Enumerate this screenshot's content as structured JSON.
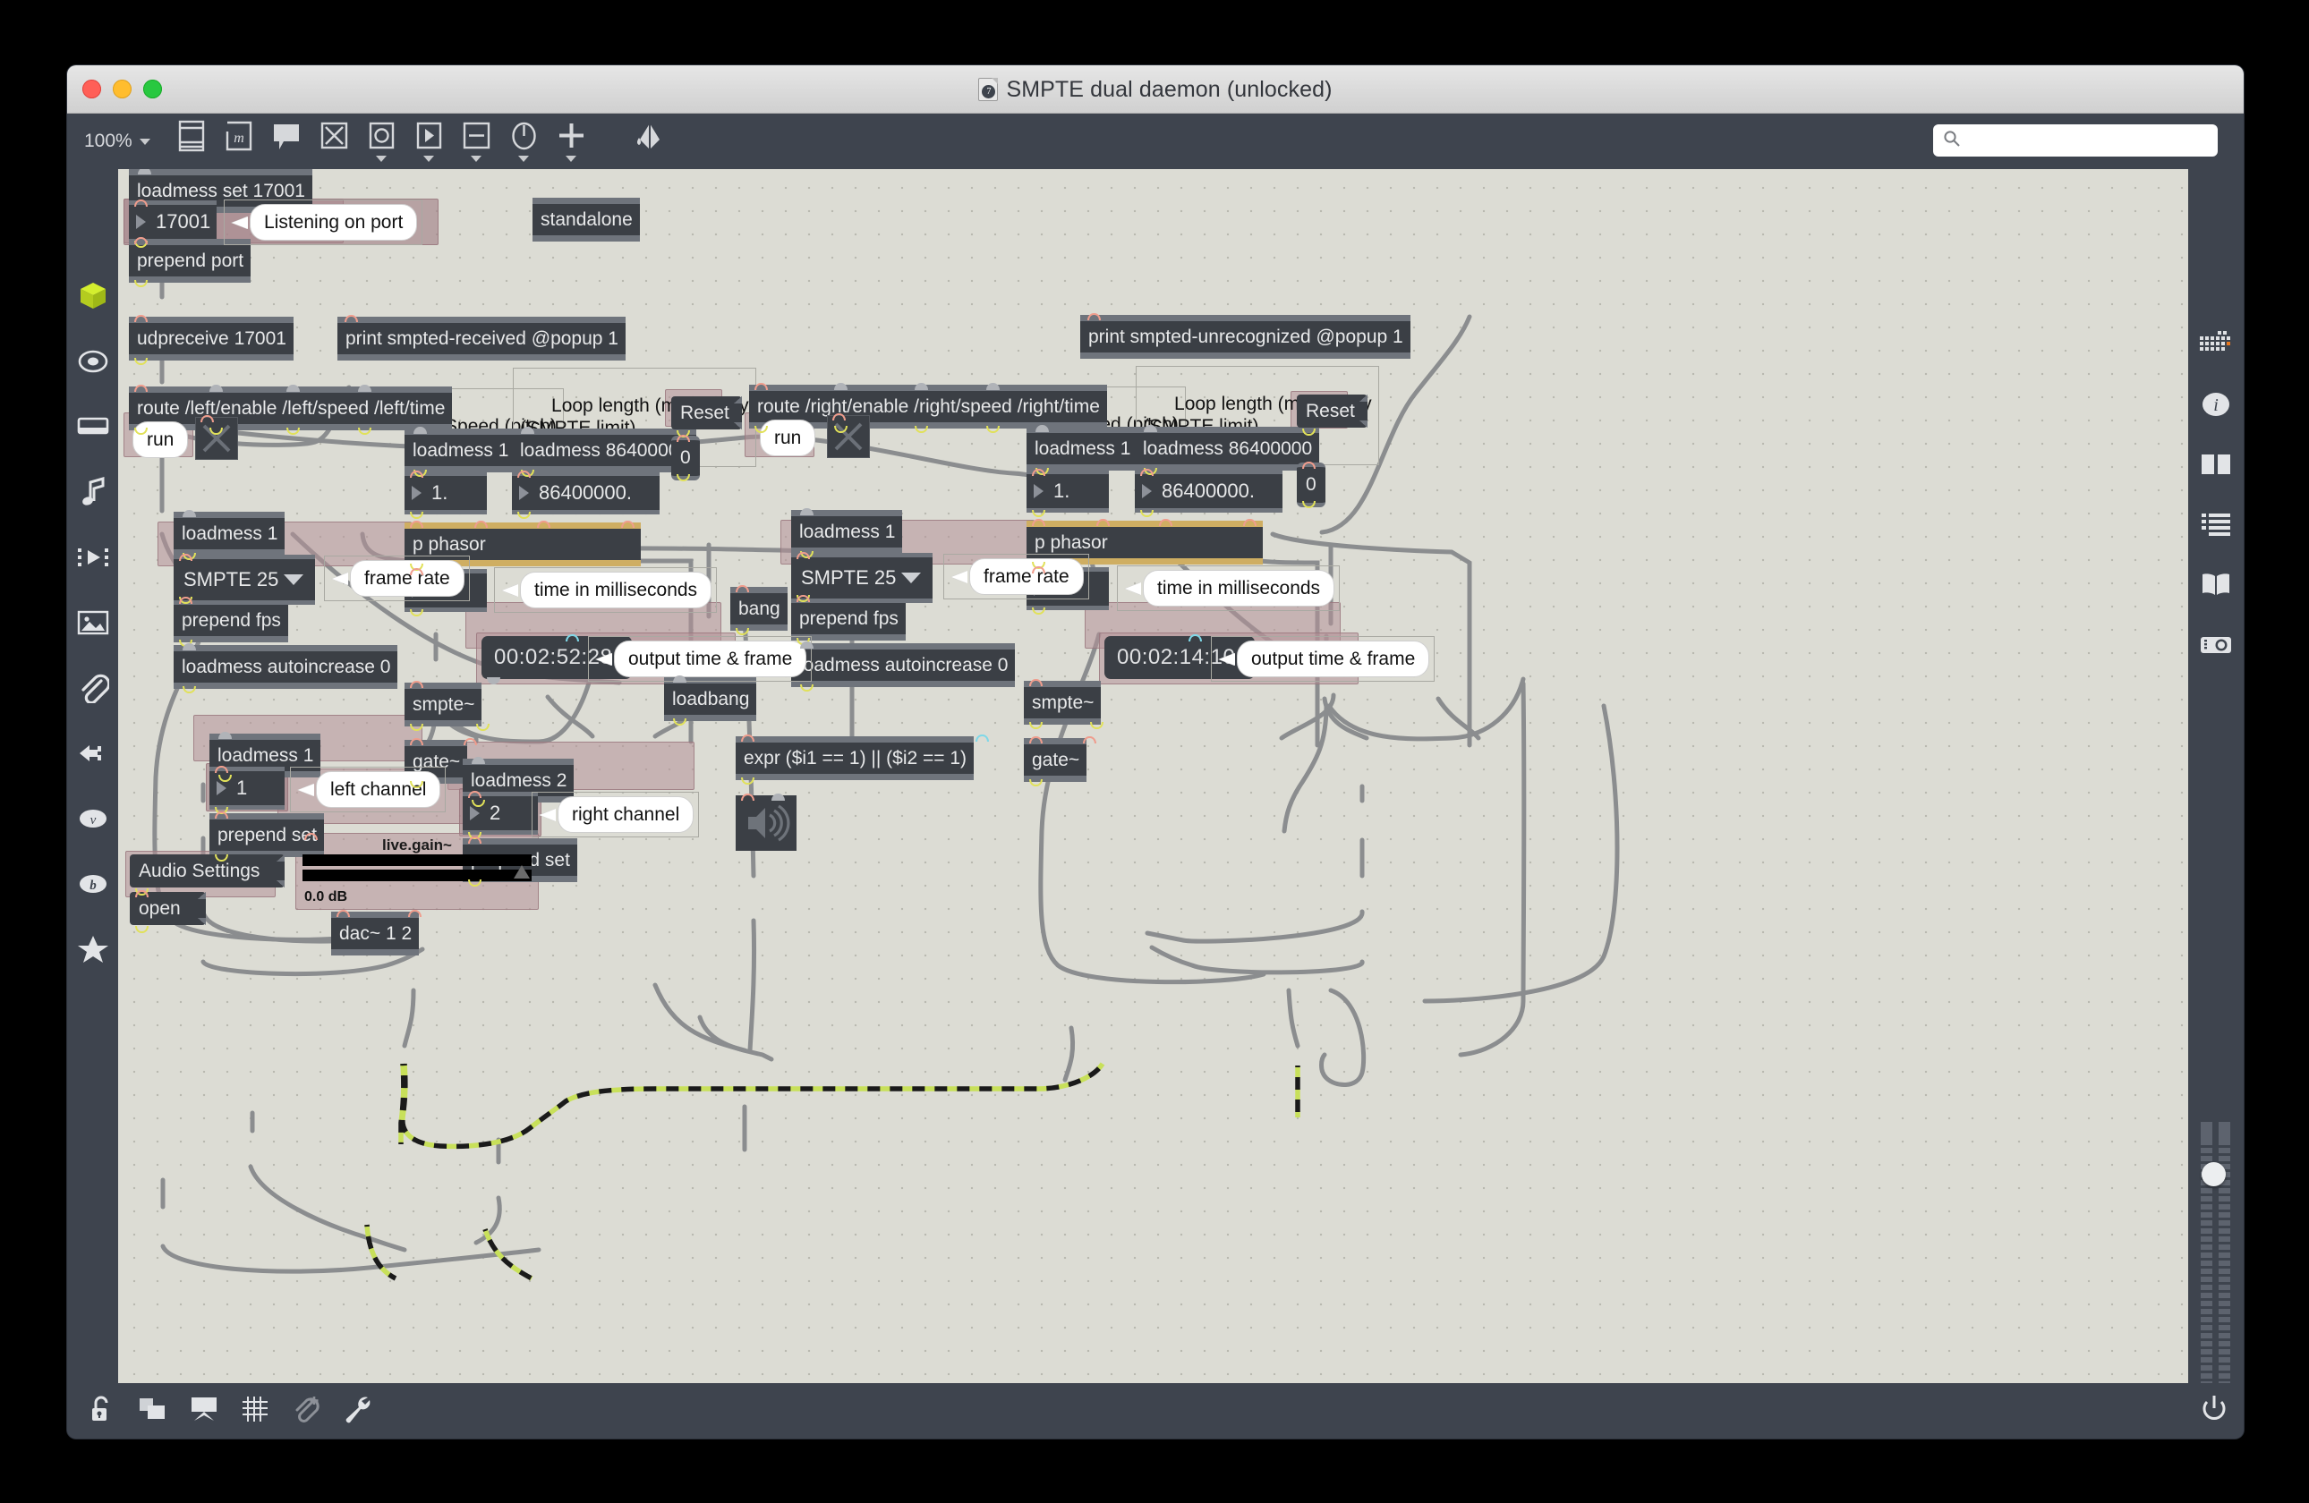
{
  "window": {
    "title": "SMPTE dual daemon (unlocked)",
    "doc_badge": "7"
  },
  "toolbar": {
    "zoom_level": "100%",
    "buttons": [
      {
        "name": "patcher-window-icon",
        "label": "Patcher window"
      },
      {
        "name": "max-object-icon",
        "label": "m"
      },
      {
        "name": "comment-icon",
        "label": "Comment"
      },
      {
        "name": "toggle-icon",
        "label": "Toggle"
      },
      {
        "name": "button-icon",
        "label": "Button"
      },
      {
        "name": "message-icon",
        "label": "Message"
      },
      {
        "name": "number-icon",
        "label": "Number"
      },
      {
        "name": "dial-icon",
        "label": "Dial"
      },
      {
        "name": "plus-icon",
        "label": "Add"
      },
      {
        "name": "paint-bucket-icon",
        "label": "Format"
      }
    ],
    "search_placeholder": ""
  },
  "left_rail": [
    {
      "name": "sidebar-item-packages",
      "icon": "green-cube-icon"
    },
    {
      "name": "sidebar-item-target",
      "icon": "target-icon"
    },
    {
      "name": "sidebar-item-keyboard",
      "icon": "keyboard-icon"
    },
    {
      "name": "sidebar-item-audio",
      "icon": "music-note-icon"
    },
    {
      "name": "sidebar-item-video",
      "icon": "play-film-icon"
    },
    {
      "name": "sidebar-item-image",
      "icon": "picture-icon"
    },
    {
      "name": "sidebar-item-attachment",
      "icon": "paperclip-icon"
    },
    {
      "name": "sidebar-item-plug",
      "icon": "plug-icon"
    },
    {
      "name": "sidebar-item-vizzie",
      "icon": "vizzie-v-icon"
    },
    {
      "name": "sidebar-item-beap",
      "icon": "beap-b-icon"
    },
    {
      "name": "sidebar-item-favorites",
      "icon": "star-icon"
    }
  ],
  "right_rail": [
    {
      "name": "sidebar-item-matrix",
      "icon": "pixel-grid-icon"
    },
    {
      "name": "sidebar-item-info",
      "icon": "info-icon"
    },
    {
      "name": "sidebar-item-panels",
      "icon": "two-panel-icon"
    },
    {
      "name": "sidebar-item-list",
      "icon": "list-icon"
    },
    {
      "name": "sidebar-item-reference",
      "icon": "book-icon"
    },
    {
      "name": "sidebar-item-snapshot",
      "icon": "camera-icon"
    }
  ],
  "bottom_bar": [
    {
      "name": "lock-toggle-button",
      "icon": "unlocked-padlock-icon"
    },
    {
      "name": "presentation-mode-button",
      "icon": "overlapping-squares-icon"
    },
    {
      "name": "presentation-view-button",
      "icon": "presentation-screen-icon"
    },
    {
      "name": "grid-snap-button",
      "icon": "grid-icon"
    },
    {
      "name": "add-attachment-button",
      "icon": "paperclip-plus-icon"
    },
    {
      "name": "inspector-button",
      "icon": "wrench-icon"
    }
  ],
  "power_button": {
    "name": "audio-power-button",
    "icon": "power-icon"
  },
  "patcher": {
    "objects": [
      {
        "id": "loadmess-set-port",
        "text": "loadmess set 17001",
        "type": "object"
      },
      {
        "id": "port-number",
        "text": "17001",
        "type": "number"
      },
      {
        "id": "listening-on-port",
        "text": "Listening on port",
        "type": "bubble"
      },
      {
        "id": "standalone",
        "text": "standalone",
        "type": "object"
      },
      {
        "id": "prepend-port",
        "text": "prepend port",
        "type": "object"
      },
      {
        "id": "udpreceive",
        "text": "udpreceive 17001",
        "type": "object"
      },
      {
        "id": "print-received",
        "text": "print smpted-received @popup 1",
        "type": "object"
      },
      {
        "id": "print-unrecognized",
        "text": "print smpted-unrecognized @popup 1",
        "type": "object"
      },
      {
        "id": "route-left",
        "text": "route /left/enable /left/speed /left/time",
        "type": "object"
      },
      {
        "id": "route-right",
        "text": "route /right/enable /right/speed /right/time",
        "type": "object"
      },
      {
        "id": "run-left",
        "text": "run",
        "type": "bubble"
      },
      {
        "id": "run-right",
        "text": "run",
        "type": "bubble"
      },
      {
        "id": "speed-pitch-left",
        "text": "Speed (pitch)",
        "type": "comment"
      },
      {
        "id": "speed-pitch-right",
        "text": "Speed (pitch)",
        "type": "comment"
      },
      {
        "id": "loop-length-left",
        "text": "Loop length (ms): 1 day\n(SMPTE limit)",
        "type": "comment"
      },
      {
        "id": "loop-length-right",
        "text": "Loop length (ms): 1 day\n(SMPTE limit)",
        "type": "comment"
      },
      {
        "id": "loadmess-1-speed-left",
        "text": "loadmess 1",
        "type": "object"
      },
      {
        "id": "loadmess-1-speed-right",
        "text": "loadmess 1",
        "type": "object"
      },
      {
        "id": "speed-value-left",
        "text": "1.",
        "type": "number"
      },
      {
        "id": "speed-value-right",
        "text": "1.",
        "type": "number"
      },
      {
        "id": "loadmess-loop-left",
        "text": "loadmess 86400000",
        "type": "object"
      },
      {
        "id": "loadmess-loop-right",
        "text": "loadmess 86400000",
        "type": "object"
      },
      {
        "id": "loop-value-left",
        "text": "86400000.",
        "type": "number"
      },
      {
        "id": "loop-value-right",
        "text": "86400000.",
        "type": "number"
      },
      {
        "id": "reset-left",
        "text": "Reset",
        "type": "message"
      },
      {
        "id": "reset-right",
        "text": "Reset",
        "type": "message"
      },
      {
        "id": "reset-int-left",
        "text": "0",
        "type": "intbox"
      },
      {
        "id": "reset-int-right",
        "text": "0",
        "type": "intbox"
      },
      {
        "id": "p-phasor-left",
        "text": "p phasor",
        "type": "subpatcher"
      },
      {
        "id": "p-phasor-right",
        "text": "p phasor",
        "type": "subpatcher"
      },
      {
        "id": "phasor-out-left",
        "text": "0.",
        "type": "number"
      },
      {
        "id": "phasor-out-right",
        "text": "0.",
        "type": "number"
      },
      {
        "id": "time-ms-left",
        "text": "time in milliseconds",
        "type": "bubble"
      },
      {
        "id": "time-ms-right",
        "text": "time in milliseconds",
        "type": "bubble"
      },
      {
        "id": "loadmess-fps-left",
        "text": "loadmess 1",
        "type": "object"
      },
      {
        "id": "loadmess-fps-right",
        "text": "loadmess 1",
        "type": "object"
      },
      {
        "id": "smpte-menu-left",
        "text": "SMPTE 25",
        "type": "umenu"
      },
      {
        "id": "smpte-menu-right",
        "text": "SMPTE 25",
        "type": "umenu"
      },
      {
        "id": "frame-rate-left",
        "text": "frame rate",
        "type": "bubble"
      },
      {
        "id": "frame-rate-right",
        "text": "frame rate",
        "type": "bubble"
      },
      {
        "id": "prepend-fps-left",
        "text": "prepend fps",
        "type": "object"
      },
      {
        "id": "prepend-fps-right",
        "text": "prepend fps",
        "type": "object"
      },
      {
        "id": "autoincrease-left",
        "text": "loadmess autoincrease 0",
        "type": "object"
      },
      {
        "id": "autoincrease-right",
        "text": "loadmess autoincrease 0",
        "type": "object"
      },
      {
        "id": "smpte-time-left",
        "text": "00:02:52:28",
        "type": "smpte-display"
      },
      {
        "id": "smpte-time-right",
        "text": "00:02:14:10",
        "type": "smpte-display"
      },
      {
        "id": "output-frame-left",
        "text": "output time & frame",
        "type": "bubble"
      },
      {
        "id": "output-frame-right",
        "text": "output time & frame",
        "type": "bubble"
      },
      {
        "id": "smpte-tilde-left",
        "text": "smpte~",
        "type": "object"
      },
      {
        "id": "smpte-tilde-right",
        "text": "smpte~",
        "type": "object"
      },
      {
        "id": "gate-tilde-left",
        "text": "gate~",
        "type": "object"
      },
      {
        "id": "gate-tilde-right",
        "text": "gate~",
        "type": "object"
      },
      {
        "id": "bang",
        "text": "bang",
        "type": "object"
      },
      {
        "id": "loadbang",
        "text": "loadbang",
        "type": "object"
      },
      {
        "id": "expr",
        "text": "expr ($i1 == 1) || ($i2 == 1)",
        "type": "object"
      },
      {
        "id": "loadmess-1-chan",
        "text": "loadmess 1",
        "type": "object"
      },
      {
        "id": "loadmess-2-chan",
        "text": "loadmess 2",
        "type": "object"
      },
      {
        "id": "chan-left-value",
        "text": "1",
        "type": "number"
      },
      {
        "id": "chan-right-value",
        "text": "2",
        "type": "number"
      },
      {
        "id": "left-channel",
        "text": "left channel",
        "type": "bubble"
      },
      {
        "id": "right-channel",
        "text": "right channel",
        "type": "bubble"
      },
      {
        "id": "prepend-set-left",
        "text": "prepend set",
        "type": "object"
      },
      {
        "id": "prepend-set-right",
        "text": "prepend set",
        "type": "object"
      },
      {
        "id": "audio-settings",
        "text": "Audio Settings",
        "type": "message"
      },
      {
        "id": "open",
        "text": "open",
        "type": "message"
      },
      {
        "id": "live-gain",
        "text": "live.gain~",
        "type": "ui"
      },
      {
        "id": "live-gain-db",
        "text": "0.0 dB",
        "type": "ui-label"
      },
      {
        "id": "dac",
        "text": "dac~ 1 2",
        "type": "object"
      },
      {
        "id": "ezdac",
        "text": "",
        "type": "ezdac"
      }
    ]
  },
  "colors": {
    "object_bg": "#3b3f45",
    "object_border": "#6f747c",
    "signal_border": "#cfae62",
    "canvas_bg": "#dcdcd4",
    "chrome_bg": "#3e444e",
    "selection": "#b59298",
    "inlet": "#ef9d8d",
    "outlet": "#e1e15a",
    "signal_cord": "#c8e05a",
    "accent_green": "#c5e63c"
  }
}
